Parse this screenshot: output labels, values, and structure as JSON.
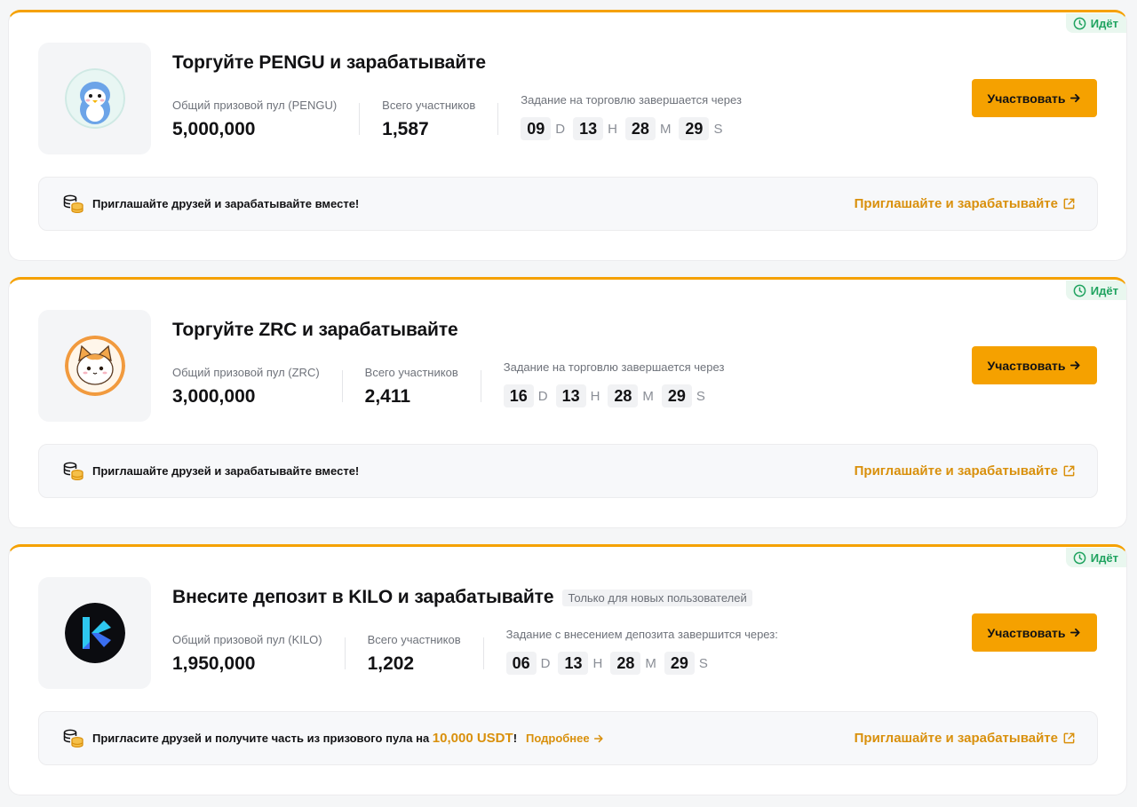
{
  "status_label": "Идёт",
  "join_label": "Участвовать",
  "invite_link_label": "Приглашайте и зарабатывайте",
  "colors": {
    "accent": "#f5a100",
    "link": "#d9900c",
    "status": "#1fa35f"
  },
  "campaigns": [
    {
      "title": "Торгуйте PENGU и зарабатывайте",
      "tag": "",
      "logo_icon": "pengu-penguin-icon",
      "pool_label": "Общий призовой пул (PENGU)",
      "pool_value": "5,000,000",
      "participants_label": "Всего участников",
      "participants_value": "1,587",
      "countdown_label": "Задание на торговлю завершается через",
      "countdown": {
        "d": "09",
        "h": "13",
        "m": "28",
        "s": "29"
      },
      "invite_text": "Приглашайте друзей и зарабатывайте вместе!"
    },
    {
      "title": "Торгуйте ZRC и зарабатывайте",
      "tag": "",
      "logo_icon": "zrc-cat-icon",
      "pool_label": "Общий призовой пул (ZRC)",
      "pool_value": "3,000,000",
      "participants_label": "Всего участников",
      "participants_value": "2,411",
      "countdown_label": "Задание на торговлю завершается через",
      "countdown": {
        "d": "16",
        "h": "13",
        "m": "28",
        "s": "29"
      },
      "invite_text": "Приглашайте друзей и зарабатывайте вместе!"
    },
    {
      "title": "Внесите депозит в KILO и зарабатывайте",
      "tag": "Только для новых пользователей",
      "logo_icon": "kilo-k-icon",
      "pool_label": "Общий призовой пул (KILO)",
      "pool_value": "1,950,000",
      "participants_label": "Всего участников",
      "participants_value": "1,202",
      "countdown_label": "Задание с внесением депозита завершится через:",
      "countdown": {
        "d": "06",
        "h": "13",
        "m": "28",
        "s": "29"
      },
      "invite_text_prefix": "Пригласите друзей и получите часть из призового пула на ",
      "invite_highlight": "10,000 USDT",
      "invite_text_suffix": "!",
      "more_label": "Подробнее"
    }
  ],
  "units": {
    "d": "D",
    "h": "H",
    "m": "M",
    "s": "S"
  }
}
